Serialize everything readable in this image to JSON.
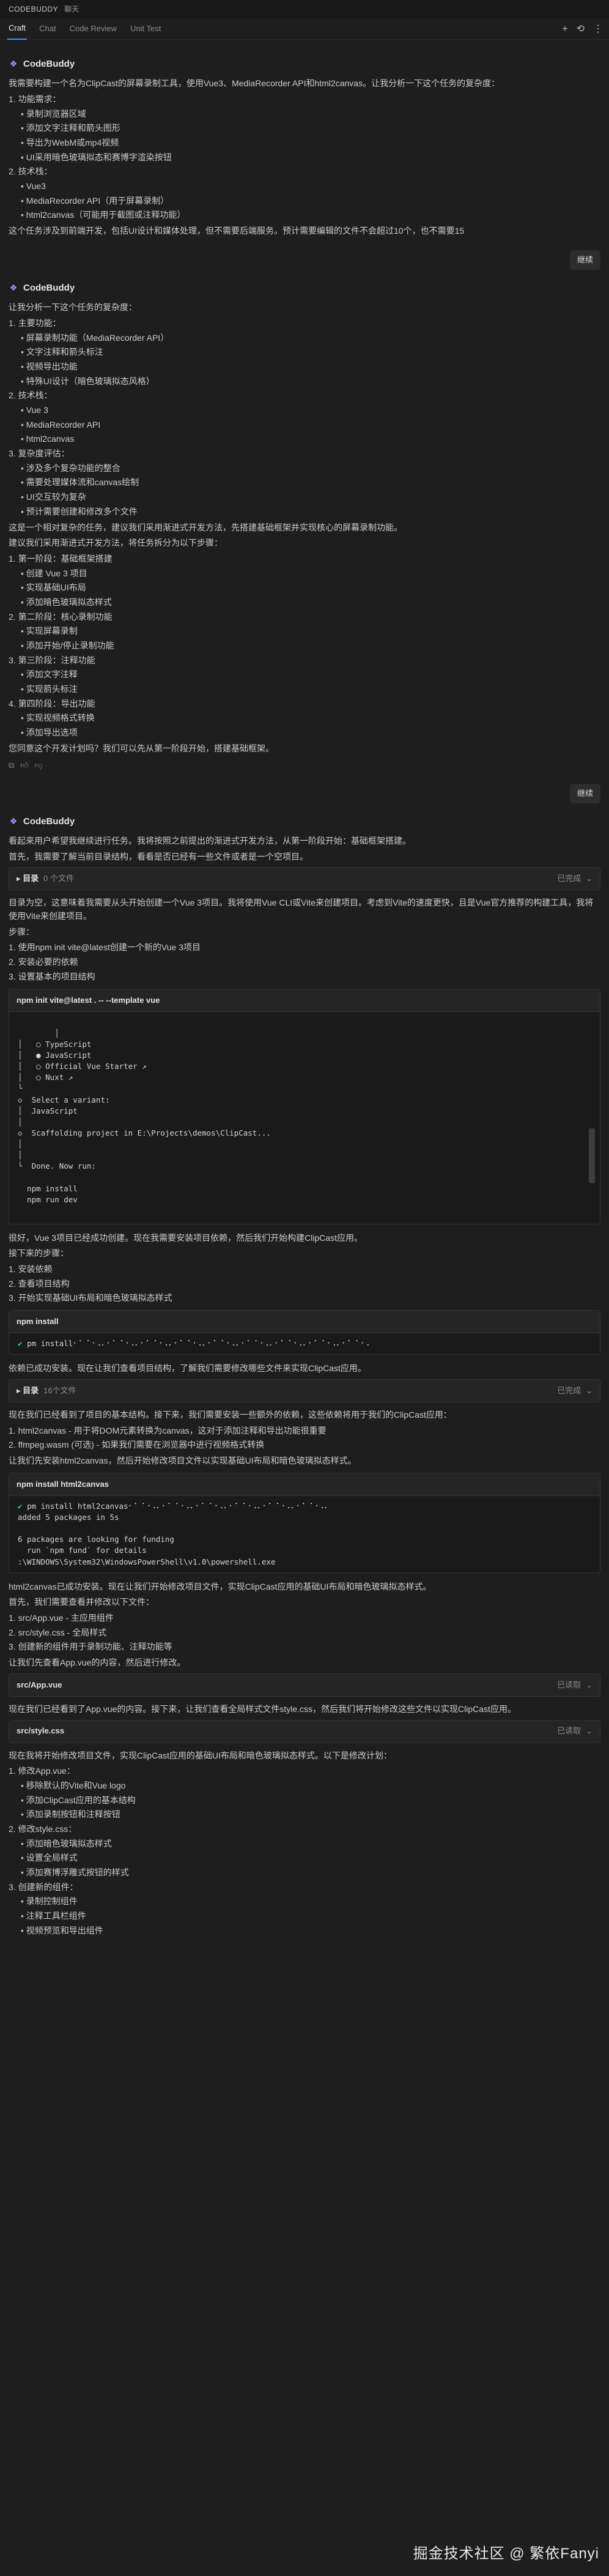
{
  "titlebar": {
    "app": "CODEBUDDY",
    "sub": "聊天"
  },
  "tabs": [
    "Craft",
    "Chat",
    "Code Review",
    "Unit Test"
  ],
  "toolbar_icons": [
    "plus-icon",
    "history-icon",
    "more-icon"
  ],
  "bot_name": "CodeBuddy",
  "messages": [
    {
      "intro": "我需要构建一个名为ClipCast的屏幕录制工具，使用Vue3、MediaRecorder API和html2canvas。让我分析一下这个任务的复杂度：",
      "items": [
        {
          "t": "1. 功能需求：",
          "sub": false
        },
        {
          "t": "录制浏览器区域",
          "sub": true
        },
        {
          "t": "添加文字注释和箭头图形",
          "sub": true
        },
        {
          "t": "导出为WebM或mp4视频",
          "sub": true
        },
        {
          "t": "UI采用暗色玻璃拟态和赛博字渲染按钮",
          "sub": true
        },
        {
          "t": "2. 技术栈：",
          "sub": false
        },
        {
          "t": "Vue3",
          "sub": true
        },
        {
          "t": "MediaRecorder API（用于屏幕录制）",
          "sub": true
        },
        {
          "t": "html2canvas（可能用于截图或注释功能）",
          "sub": true
        }
      ],
      "outro": "这个任务涉及到前端开发，包括UI设计和媒体处理，但不需要后端服务。预计需要编辑的文件不会超过10个，也不需要15"
    }
  ],
  "user1": "继续",
  "m2": {
    "intro": "让我分析一下这个任务的复杂度：",
    "items": [
      {
        "t": "1. 主要功能：",
        "sub": false
      },
      {
        "t": "屏幕录制功能（MediaRecorder API）",
        "sub": true
      },
      {
        "t": "文字注释和箭头标注",
        "sub": true
      },
      {
        "t": "视频导出功能",
        "sub": true
      },
      {
        "t": "特殊UI设计（暗色玻璃拟态风格）",
        "sub": true
      },
      {
        "t": "2. 技术栈：",
        "sub": false
      },
      {
        "t": "Vue 3",
        "sub": true
      },
      {
        "t": "MediaRecorder API",
        "sub": true
      },
      {
        "t": "html2canvas",
        "sub": true
      },
      {
        "t": "3. 复杂度评估：",
        "sub": false
      },
      {
        "t": "涉及多个复杂功能的整合",
        "sub": true
      },
      {
        "t": "需要处理媒体流和canvas绘制",
        "sub": true
      },
      {
        "t": "UI交互较为复杂",
        "sub": true
      },
      {
        "t": "预计需要创建和修改多个文件",
        "sub": true
      }
    ],
    "p1": "这是一个相对复杂的任务，建议我们采用渐进式开发方法，先搭建基础框架并实现核心的屏幕录制功能。",
    "p2": "建议我们采用渐进式开发方法，将任务拆分为以下步骤：",
    "items2": [
      {
        "t": "1. 第一阶段：基础框架搭建",
        "sub": false
      },
      {
        "t": "创建 Vue 3 项目",
        "sub": true
      },
      {
        "t": "实现基础UI布局",
        "sub": true
      },
      {
        "t": "添加暗色玻璃拟态样式",
        "sub": true
      },
      {
        "t": "2. 第二阶段：核心录制功能",
        "sub": false
      },
      {
        "t": "实现屏幕录制",
        "sub": true
      },
      {
        "t": "添加开始/停止录制功能",
        "sub": true
      },
      {
        "t": "3. 第三阶段：注释功能",
        "sub": false
      },
      {
        "t": "添加文字注释",
        "sub": true
      },
      {
        "t": "实现箭头标注",
        "sub": true
      },
      {
        "t": "4. 第四阶段：导出功能",
        "sub": false
      },
      {
        "t": "实现视频格式转换",
        "sub": true
      },
      {
        "t": "添加导出选项",
        "sub": true
      }
    ],
    "p3": "您同意这个开发计划吗？我们可以先从第一阶段开始，搭建基础框架。"
  },
  "user2": "继续",
  "m3": {
    "p1": "看起来用户希望我继续进行任务。我将按照之前提出的渐进式开发方法，从第一阶段开始：基础框架搭建。",
    "p2": "首先，我需要了解当前目录结构，看看是否已经有一些文件或者是一个空项目。",
    "box1": {
      "title": "▸ 目录",
      "sub": "0 个文件",
      "status": "已完成"
    },
    "p3": "目录为空，这意味着我需要从头开始创建一个Vue 3项目。我将使用Vue CLI或Vite来创建项目。考虑到Vite的速度更快，且是Vue官方推荐的构建工具，我将使用Vite来创建项目。",
    "p4": "步骤：",
    "steps": [
      "1. 使用npm init vite@latest创建一个新的Vue 3项目",
      "2. 安装必要的依赖",
      "3. 设置基本的项目结构"
    ],
    "term1": {
      "head": "npm init vite@latest . -- --template vue",
      "body": "│\n│   ○ TypeScript\n│   ● JavaScript\n│   ○ Official Vue Starter ↗\n│   ○ Nuxt ↗\n└\n◇  Select a variant:\n│  JavaScript\n│\n◇  Scaffolding project in E:\\Projects\\demos\\ClipCast...\n│\n│\n└  Done. Now run:\n\n  npm install\n  npm run dev"
    },
    "p5": "很好，Vue 3项目已经成功创建。现在我需要安装项目依赖，然后我们开始构建ClipCast应用。",
    "p6": "接下来的步骤：",
    "steps2": [
      "1. 安装依赖",
      "2. 查看项目结构",
      "3. 开始实现基础UI布局和暗色玻璃拟态样式"
    ],
    "term2": {
      "head": "npm install",
      "body": "pm install⠂⠁⠈⠐⠠⠄⠂⠁⠈⠐⠠⠄⠂⠁⠈⠐⠠⠄⠂⠁⠈⠐⠠⠄⠂⠁⠈⠐⠠⠄⠂⠁⠈⠐⠠⠄⠂⠁⠈⠐⠠⠄⠂⠁⠈⠐⠠⠄⠂⠁⠈⠐⠠"
    },
    "p7": "依赖已成功安装。现在让我们查看项目结构，了解我们需要修改哪些文件来实现ClipCast应用。",
    "box2": {
      "title": "▸ 目录",
      "sub": "16个文件",
      "status": "已完成"
    },
    "p8": "现在我们已经看到了项目的基本结构。接下来，我们需要安装一些额外的依赖，这些依赖将用于我们的ClipCast应用：",
    "deps": [
      "1. html2canvas - 用于将DOM元素转换为canvas，这对于添加注释和导出功能很重要",
      "2. ffmpeg.wasm (可选) - 如果我们需要在浏览器中进行视频格式转换"
    ],
    "p9": "让我们先安装html2canvas，然后开始修改项目文件以实现基础UI布局和暗色玻璃拟态样式。",
    "term3": {
      "head": "npm install html2canvas",
      "body": "pm install html2canvas⠂⠁⠈⠐⠠⠄⠂⠁⠈⠐⠠⠄⠂⠁⠈⠐⠠⠄⠂⠁⠈⠐⠠⠄⠂⠁⠈⠐⠠⠄⠂⠁⠈⠐⠠⠄\nadded 5 packages in 5s\n\n6 packages are looking for funding\n  run `npm fund` for details\n:\\WINDOWS\\System32\\WindowsPowerShell\\v1.0\\powershell.exe"
    },
    "p10": "html2canvas已成功安装。现在让我们开始修改项目文件，实现ClipCast应用的基础UI布局和暗色玻璃拟态样式。",
    "p11": "首先，我们需要查看并修改以下文件：",
    "files": [
      "1. src/App.vue - 主应用组件",
      "2. src/style.css - 全局样式",
      "3. 创建新的组件用于录制功能、注释功能等"
    ],
    "p12": "让我们先查看App.vue的内容，然后进行修改。",
    "box3": {
      "title": "src/App.vue",
      "sub": "",
      "status": "已读取"
    },
    "p13": "现在我们已经看到了App.vue的内容。接下来，让我们查看全局样式文件style.css，然后我们将开始修改这些文件以实现ClipCast应用。",
    "box4": {
      "title": "src/style.css",
      "sub": "",
      "status": "已读取"
    },
    "p14": "现在我将开始修改项目文件，实现ClipCast应用的基础UI布局和暗色玻璃拟态样式。以下是修改计划：",
    "plan": [
      {
        "t": "1. 修改App.vue：",
        "sub": false
      },
      {
        "t": "移除默认的Vite和Vue logo",
        "sub": true
      },
      {
        "t": "添加ClipCast应用的基本结构",
        "sub": true
      },
      {
        "t": "添加录制按钮和注释按钮",
        "sub": true
      },
      {
        "t": "2. 修改style.css：",
        "sub": false
      },
      {
        "t": "添加暗色玻璃拟态样式",
        "sub": true
      },
      {
        "t": "设置全局样式",
        "sub": true
      },
      {
        "t": "添加赛博浮雕式按钮的样式",
        "sub": true
      },
      {
        "t": "3. 创建新的组件：",
        "sub": false
      },
      {
        "t": "录制控制组件",
        "sub": true
      },
      {
        "t": "注释工具栏组件",
        "sub": true
      },
      {
        "t": "视频预览和导出组件",
        "sub": true
      }
    ]
  },
  "watermark": "掘金技术社区 @ 繁依Fanyi"
}
